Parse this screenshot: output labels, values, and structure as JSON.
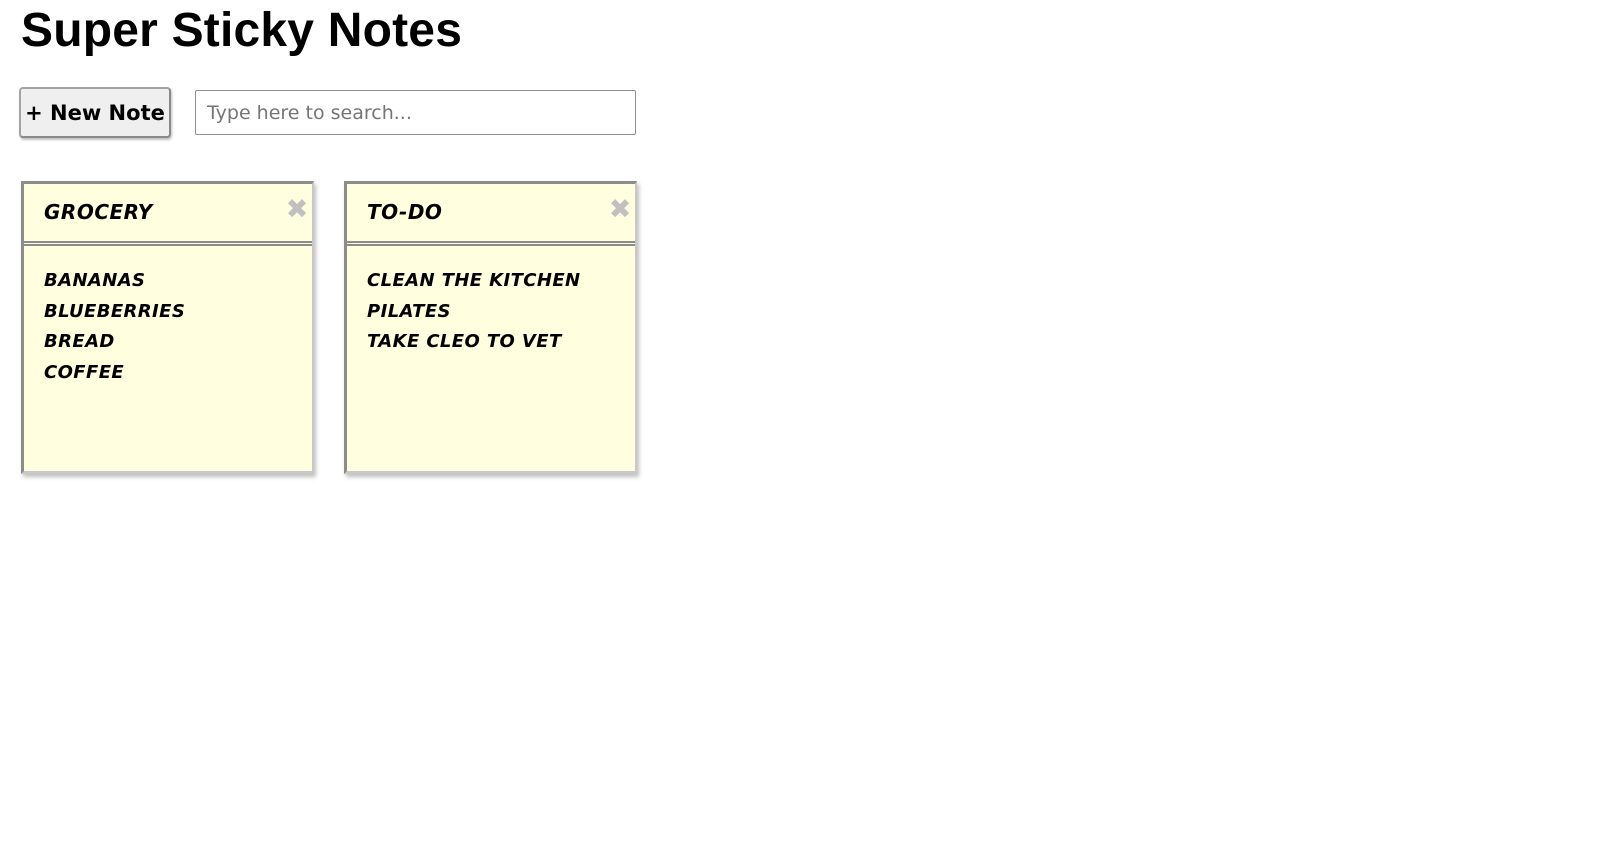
{
  "app": {
    "title": "Super Sticky Notes"
  },
  "toolbar": {
    "new_note_label": "+ New Note",
    "search_placeholder": "Type here to search...",
    "search_value": ""
  },
  "notes": [
    {
      "title": "Grocery",
      "close_label": "✖",
      "lines": [
        "Bananas",
        "Blueberries",
        "Bread",
        "Coffee"
      ]
    },
    {
      "title": "To-Do",
      "close_label": "✖",
      "lines": [
        "Clean the kitchen",
        "Pilates",
        "Take Cleo to vet"
      ]
    }
  ],
  "colors": {
    "note_background": "#ffffe0",
    "note_border": "#8c8c8c",
    "close_icon": "#c0c0c0"
  }
}
